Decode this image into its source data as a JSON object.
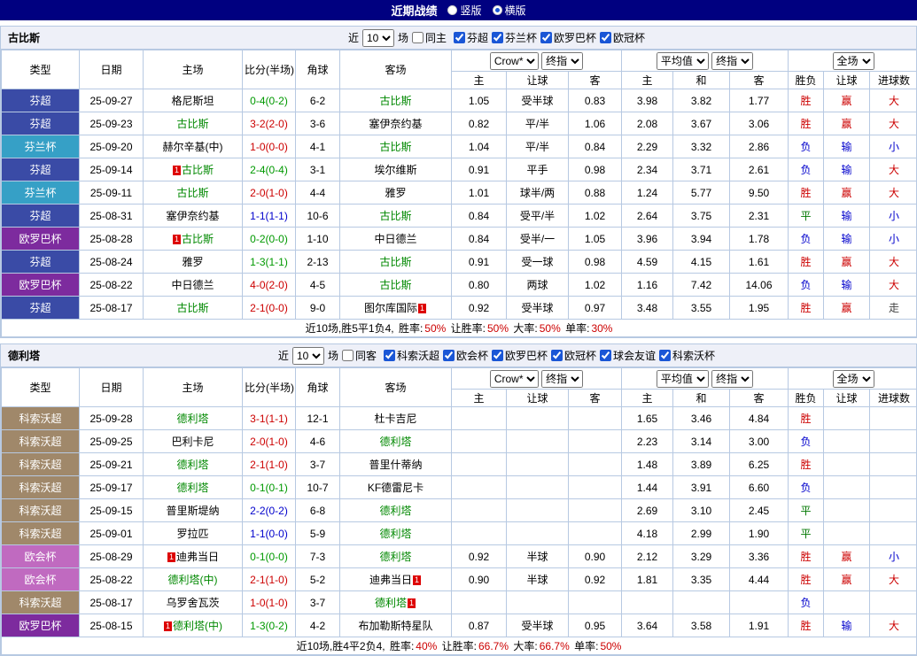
{
  "topbar": {
    "title": "近期战绩",
    "vertical": "竖版",
    "horizontal": "横版"
  },
  "table_header": {
    "type": "类型",
    "date": "日期",
    "home": "主场",
    "score": "比分(半场)",
    "corner": "角球",
    "away": "客场",
    "h": "主",
    "handicap": "让球",
    "a": "客",
    "avg_h": "主",
    "avg_d": "和",
    "avg_a": "客",
    "wdl": "胜负",
    "let": "让球",
    "goals": "进球数",
    "crow": "Crow*",
    "final": "终指",
    "avg": "平均值",
    "full": "全场"
  },
  "league_colors": {
    "芬超": "#3a4ba6",
    "芬兰杯": "#36a0c6",
    "欧罗巴杯": "#7d2b9e",
    "科索沃超": "#a0886a",
    "欧会杯": "#c06ac0"
  },
  "score_colors": {
    "r": "#cc0000",
    "g": "#009900",
    "b": "#0000cc"
  },
  "result_colors": {
    "胜": "#cc0000",
    "赢": "#cc0000",
    "大": "#cc0000",
    "负": "#0000cc",
    "输": "#0000cc",
    "小": "#0000cc",
    "平": "#007700",
    "走": "#444444"
  },
  "focus_color": "#008800",
  "sections": [
    {
      "team": "古比斯",
      "filter": {
        "near": "近",
        "count": "10",
        "games": "场",
        "same": "同主",
        "leagues": [
          "芬超",
          "芬兰杯",
          "欧罗巴杯",
          "欧冠杯"
        ]
      },
      "rows": [
        {
          "league": "芬超",
          "date": "25-09-27",
          "home": "格尼斯坦",
          "score": "0-4(0-2)",
          "score_c": "g",
          "corner": "6-2",
          "away": "古比斯",
          "away_focus": true,
          "odds": [
            "1.05",
            "受半球",
            "0.83"
          ],
          "avg": [
            "3.98",
            "3.82",
            "1.77"
          ],
          "results": [
            "胜",
            "赢",
            "大"
          ]
        },
        {
          "league": "芬超",
          "date": "25-09-23",
          "home": "古比斯",
          "home_focus": true,
          "score": "3-2(2-0)",
          "score_c": "r",
          "corner": "3-6",
          "away": "塞伊奈约基",
          "odds": [
            "0.82",
            "平/半",
            "1.06"
          ],
          "avg": [
            "2.08",
            "3.67",
            "3.06"
          ],
          "results": [
            "胜",
            "赢",
            "大"
          ]
        },
        {
          "league": "芬兰杯",
          "date": "25-09-20",
          "home": "赫尔辛基(中)",
          "score": "1-0(0-0)",
          "score_c": "r",
          "corner": "4-1",
          "away": "古比斯",
          "away_focus": true,
          "odds": [
            "1.04",
            "平/半",
            "0.84"
          ],
          "avg": [
            "2.29",
            "3.32",
            "2.86"
          ],
          "results": [
            "负",
            "输",
            "小"
          ]
        },
        {
          "league": "芬超",
          "date": "25-09-14",
          "home": "古比斯",
          "home_focus": true,
          "home_rc": "pre",
          "score": "2-4(0-4)",
          "score_c": "g",
          "corner": "3-1",
          "away": "埃尔维斯",
          "odds": [
            "0.91",
            "平手",
            "0.98"
          ],
          "avg": [
            "2.34",
            "3.71",
            "2.61"
          ],
          "results": [
            "负",
            "输",
            "大"
          ]
        },
        {
          "league": "芬兰杯",
          "date": "25-09-11",
          "home": "古比斯",
          "home_focus": true,
          "score": "2-0(1-0)",
          "score_c": "r",
          "corner": "4-4",
          "away": "雅罗",
          "odds": [
            "1.01",
            "球半/两",
            "0.88"
          ],
          "avg": [
            "1.24",
            "5.77",
            "9.50"
          ],
          "results": [
            "胜",
            "赢",
            "大"
          ]
        },
        {
          "league": "芬超",
          "date": "25-08-31",
          "home": "塞伊奈约基",
          "score": "1-1(1-1)",
          "score_c": "b",
          "corner": "10-6",
          "away": "古比斯",
          "away_focus": true,
          "odds": [
            "0.84",
            "受平/半",
            "1.02"
          ],
          "avg": [
            "2.64",
            "3.75",
            "2.31"
          ],
          "results": [
            "平",
            "输",
            "小"
          ]
        },
        {
          "league": "欧罗巴杯",
          "date": "25-08-28",
          "home": "古比斯",
          "home_focus": true,
          "home_rc": "pre",
          "score": "0-2(0-0)",
          "score_c": "g",
          "corner": "1-10",
          "away": "中日德兰",
          "odds": [
            "0.84",
            "受半/一",
            "1.05"
          ],
          "avg": [
            "3.96",
            "3.94",
            "1.78"
          ],
          "results": [
            "负",
            "输",
            "小"
          ]
        },
        {
          "league": "芬超",
          "date": "25-08-24",
          "home": "雅罗",
          "score": "1-3(1-1)",
          "score_c": "g",
          "corner": "2-13",
          "away": "古比斯",
          "away_focus": true,
          "odds": [
            "0.91",
            "受一球",
            "0.98"
          ],
          "avg": [
            "4.59",
            "4.15",
            "1.61"
          ],
          "results": [
            "胜",
            "赢",
            "大"
          ]
        },
        {
          "league": "欧罗巴杯",
          "date": "25-08-22",
          "home": "中日德兰",
          "score": "4-0(2-0)",
          "score_c": "r",
          "corner": "4-5",
          "away": "古比斯",
          "away_focus": true,
          "odds": [
            "0.80",
            "两球",
            "1.02"
          ],
          "avg": [
            "1.16",
            "7.42",
            "14.06"
          ],
          "results": [
            "负",
            "输",
            "大"
          ]
        },
        {
          "league": "芬超",
          "date": "25-08-17",
          "home": "古比斯",
          "home_focus": true,
          "score": "2-1(0-0)",
          "score_c": "r",
          "corner": "9-0",
          "away": "图尔库国际",
          "away_rc": "post",
          "odds": [
            "0.92",
            "受半球",
            "0.97"
          ],
          "avg": [
            "3.48",
            "3.55",
            "1.95"
          ],
          "results": [
            "胜",
            "赢",
            "走"
          ]
        }
      ],
      "summary": {
        "prefix": "近10场,胜5平1负4,",
        "stats": [
          {
            "label": "胜率:",
            "value": "50%"
          },
          {
            "label": "让胜率:",
            "value": "50%"
          },
          {
            "label": "大率:",
            "value": "50%"
          },
          {
            "label": "单率:",
            "value": "30%"
          }
        ]
      }
    },
    {
      "team": "德利塔",
      "filter": {
        "near": "近",
        "count": "10",
        "games": "场",
        "same": "同客",
        "leagues": [
          "科索沃超",
          "欧会杯",
          "欧罗巴杯",
          "欧冠杯",
          "球会友谊",
          "科索沃杯"
        ]
      },
      "rows": [
        {
          "league": "科索沃超",
          "date": "25-09-28",
          "home": "德利塔",
          "home_focus": true,
          "score": "3-1(1-1)",
          "score_c": "r",
          "corner": "12-1",
          "away": "杜卡吉尼",
          "avg": [
            "1.65",
            "3.46",
            "4.84"
          ],
          "results": [
            "胜",
            "",
            ""
          ]
        },
        {
          "league": "科索沃超",
          "date": "25-09-25",
          "home": "巴利卡尼",
          "score": "2-0(1-0)",
          "score_c": "r",
          "corner": "4-6",
          "away": "德利塔",
          "away_focus": true,
          "avg": [
            "2.23",
            "3.14",
            "3.00"
          ],
          "results": [
            "负",
            "",
            ""
          ]
        },
        {
          "league": "科索沃超",
          "date": "25-09-21",
          "home": "德利塔",
          "home_focus": true,
          "score": "2-1(1-0)",
          "score_c": "r",
          "corner": "3-7",
          "away": "普里什蒂纳",
          "avg": [
            "1.48",
            "3.89",
            "6.25"
          ],
          "results": [
            "胜",
            "",
            ""
          ]
        },
        {
          "league": "科索沃超",
          "date": "25-09-17",
          "home": "德利塔",
          "home_focus": true,
          "score": "0-1(0-1)",
          "score_c": "g",
          "corner": "10-7",
          "away": "KF德雷尼卡",
          "avg": [
            "1.44",
            "3.91",
            "6.60"
          ],
          "results": [
            "负",
            "",
            ""
          ]
        },
        {
          "league": "科索沃超",
          "date": "25-09-15",
          "home": "普里斯堤纳",
          "score": "2-2(0-2)",
          "score_c": "b",
          "corner": "6-8",
          "away": "德利塔",
          "away_focus": true,
          "avg": [
            "2.69",
            "3.10",
            "2.45"
          ],
          "results": [
            "平",
            "",
            ""
          ]
        },
        {
          "league": "科索沃超",
          "date": "25-09-01",
          "home": "罗拉匹",
          "score": "1-1(0-0)",
          "score_c": "b",
          "corner": "5-9",
          "away": "德利塔",
          "away_focus": true,
          "avg": [
            "4.18",
            "2.99",
            "1.90"
          ],
          "results": [
            "平",
            "",
            ""
          ]
        },
        {
          "league": "欧会杯",
          "date": "25-08-29",
          "home": "迪弗当日",
          "home_rc": "pre",
          "score": "0-1(0-0)",
          "score_c": "g",
          "corner": "7-3",
          "away": "德利塔",
          "away_focus": true,
          "odds": [
            "0.92",
            "半球",
            "0.90"
          ],
          "avg": [
            "2.12",
            "3.29",
            "3.36"
          ],
          "results": [
            "胜",
            "赢",
            "小"
          ]
        },
        {
          "league": "欧会杯",
          "date": "25-08-22",
          "home": "德利塔(中)",
          "home_focus": true,
          "score": "2-1(1-0)",
          "score_c": "r",
          "corner": "5-2",
          "away": "迪弗当日",
          "away_rc": "post",
          "odds": [
            "0.90",
            "半球",
            "0.92"
          ],
          "avg": [
            "1.81",
            "3.35",
            "4.44"
          ],
          "results": [
            "胜",
            "赢",
            "大"
          ]
        },
        {
          "league": "科索沃超",
          "date": "25-08-17",
          "home": "乌罗舍瓦茨",
          "score": "1-0(1-0)",
          "score_c": "r",
          "corner": "3-7",
          "away": "德利塔",
          "away_focus": true,
          "away_rc": "post",
          "results": [
            "负",
            "",
            ""
          ]
        },
        {
          "league": "欧罗巴杯",
          "date": "25-08-15",
          "home": "德利塔(中)",
          "home_focus": true,
          "home_rc": "pre",
          "score": "1-3(0-2)",
          "score_c": "g",
          "corner": "4-2",
          "away": "布加勒斯特星队",
          "odds": [
            "0.87",
            "受半球",
            "0.95"
          ],
          "avg": [
            "3.64",
            "3.58",
            "1.91"
          ],
          "results": [
            "胜",
            "输",
            "大"
          ]
        }
      ],
      "summary": {
        "prefix": "近10场,胜4平2负4,",
        "stats": [
          {
            "label": "胜率:",
            "value": "40%"
          },
          {
            "label": "让胜率:",
            "value": "66.7%"
          },
          {
            "label": "大率:",
            "value": "66.7%"
          },
          {
            "label": "单率:",
            "value": "50%"
          }
        ]
      }
    }
  ]
}
